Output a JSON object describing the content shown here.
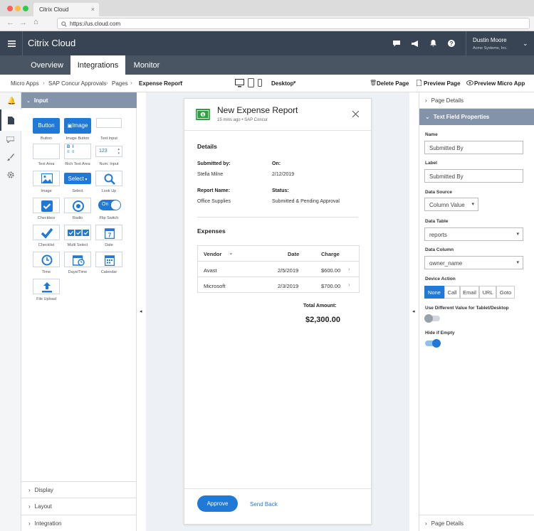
{
  "browser": {
    "tab_title": "Citrix Cloud",
    "url": "https://us.cloud.com"
  },
  "header": {
    "logo_text": "Citrix Cloud",
    "user_name": "Dustin Moore",
    "user_org": "Acme Systems, Inc."
  },
  "nav": {
    "tabs": [
      "Overview",
      "Integrations",
      "Monitor"
    ],
    "active": "Integrations"
  },
  "breadcrumb": {
    "items": [
      "Micro Apps",
      "SAP Concur Approvals",
      "Pages",
      "Expense Report"
    ],
    "device_select": "Desktop",
    "delete_page": "Delete Page",
    "preview_page": "Preview Page",
    "preview_micro_app": "Preview Micro App"
  },
  "palette": {
    "section_title": "Input",
    "button_label": "Button",
    "image_button_label": "Image",
    "select_label": "Select",
    "flip_switch_label": "On",
    "num_input_value": "123",
    "components": [
      "Button",
      "Image Button",
      "Text Input",
      "Text Area",
      "Rich Text Area",
      "Num. Input",
      "Image",
      "Select",
      "Look Up",
      "Checkbox",
      "Radio",
      "Flip Switch",
      "Checklist",
      "Multi Select",
      "Date",
      "Time",
      "Daye/Time",
      "Calendar",
      "File Upload"
    ],
    "collapsed_sections": [
      "Display",
      "Layout",
      "Integration"
    ]
  },
  "card": {
    "title": "New Expense Report",
    "subtitle": "15 mins ago • SAP Concur",
    "details_heading": "Details",
    "submitted_by_label": "Submitted by:",
    "submitted_by_value": "Stella Milne",
    "on_label": "On:",
    "on_value": "2/12/2019",
    "report_name_label": "Report Name:",
    "report_name_value": "Office Supplies",
    "status_label": "Status:",
    "status_value": "Submitted & Pending Approval",
    "expenses_heading": "Expenses",
    "table_headers": [
      "Vendor",
      "Date",
      "Charge"
    ],
    "rows": [
      {
        "vendor": "Avast",
        "date": "2/5/2019",
        "charge": "$600.00"
      },
      {
        "vendor": "Microsoft",
        "date": "2/3/2019",
        "charge": "$700.00"
      }
    ],
    "total_label": "Total Amount:",
    "total_value": "$2,300.00",
    "approve": "Approve",
    "send_back": "Send Back"
  },
  "props": {
    "page_details": "Page Details",
    "section_title": "Text Field Properties",
    "name_label": "Name",
    "name_value": "Submitted By",
    "label_label": "Label",
    "label_value": "Submitted By",
    "data_source_label": "Data Source",
    "data_source_value": "Column Value",
    "data_table_label": "Data Table",
    "data_table_value": "reports",
    "data_column_label": "Data Column",
    "data_column_value": "owner_name",
    "device_action_label": "Device Action",
    "device_actions": [
      "None",
      "Call",
      "Email",
      "URL",
      "Goto"
    ],
    "device_action_selected": "None",
    "use_different_label": "Use Different Value for Tablet/Desktop",
    "use_different_on": false,
    "hide_if_empty_label": "Hide if Empty",
    "hide_if_empty_on": true
  },
  "colors": {
    "accent": "#2079d6",
    "header_bg": "#384454",
    "nav_bg": "#4a5564",
    "section_bg": "#8393aa",
    "canvas_bg": "#edf1f6"
  }
}
